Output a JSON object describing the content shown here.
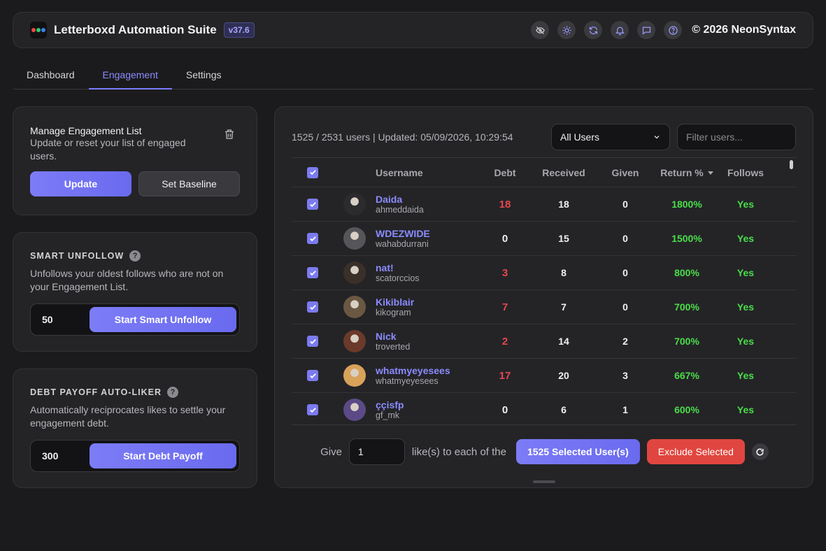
{
  "header": {
    "title": "Letterboxd Automation Suite",
    "version": "v37.6",
    "copyright": "© 2026 NeonSyntax",
    "logo_colors": [
      "#e74c3c",
      "#2ecc71",
      "#3b82f6"
    ],
    "icons": [
      "eye-off-icon",
      "sun-icon",
      "refresh-icon",
      "bell-icon",
      "chat-icon",
      "help-icon"
    ]
  },
  "tabs": [
    {
      "label": "Dashboard",
      "active": false
    },
    {
      "label": "Engagement",
      "active": true
    },
    {
      "label": "Settings",
      "active": false
    }
  ],
  "manage": {
    "title": "Manage Engagement List",
    "desc": "Update or reset your list of engaged users.",
    "update_label": "Update",
    "baseline_label": "Set Baseline"
  },
  "unfollow": {
    "title": "SMART UNFOLLOW",
    "desc": "Unfollows your oldest follows who are not on your Engagement List.",
    "value": "50",
    "button": "Start Smart Unfollow"
  },
  "payoff": {
    "title": "DEBT PAYOFF AUTO-LIKER",
    "desc": "Automatically reciprocates likes to settle your engagement debt.",
    "value": "300",
    "button": "Start Debt Payoff"
  },
  "main": {
    "stats": "1525 / 2531 users | Updated: 05/09/2026, 10:29:54",
    "filter_selected": "All Users",
    "filter_placeholder": "Filter users...",
    "columns": {
      "username": "Username",
      "debt": "Debt",
      "received": "Received",
      "given": "Given",
      "return": "Return %",
      "follows": "Follows"
    },
    "rows": [
      {
        "name": "Daida",
        "handle": "ahmeddaida",
        "debt": "18",
        "received": "18",
        "given": "0",
        "return": "1800%",
        "follows": "Yes"
      },
      {
        "name": "WDEZWIDE",
        "handle": "wahabdurrani",
        "debt": "0",
        "received": "15",
        "given": "0",
        "return": "1500%",
        "follows": "Yes"
      },
      {
        "name": "nat!",
        "handle": "scatorccios",
        "debt": "3",
        "received": "8",
        "given": "0",
        "return": "800%",
        "follows": "Yes"
      },
      {
        "name": "Kikiblair",
        "handle": "kikogram",
        "debt": "7",
        "received": "7",
        "given": "0",
        "return": "700%",
        "follows": "Yes"
      },
      {
        "name": "Nick",
        "handle": "troverted",
        "debt": "2",
        "received": "14",
        "given": "2",
        "return": "700%",
        "follows": "Yes"
      },
      {
        "name": "whatmyeyesees",
        "handle": "whatmyeyesees",
        "debt": "17",
        "received": "20",
        "given": "3",
        "return": "667%",
        "follows": "Yes"
      },
      {
        "name": "ççisfp",
        "handle": "gf_mk",
        "debt": "0",
        "received": "6",
        "given": "1",
        "return": "600%",
        "follows": "Yes"
      }
    ],
    "footer": {
      "give_label": "Give",
      "give_value": "1",
      "likes_label": "like(s) to each of the",
      "selected_button": "1525 Selected User(s)",
      "exclude_button": "Exclude Selected"
    }
  },
  "colors": {
    "accent": "#7b7bf0",
    "debt_red": "#e5484d",
    "success_green": "#4ade4a",
    "danger": "#e0463f"
  }
}
